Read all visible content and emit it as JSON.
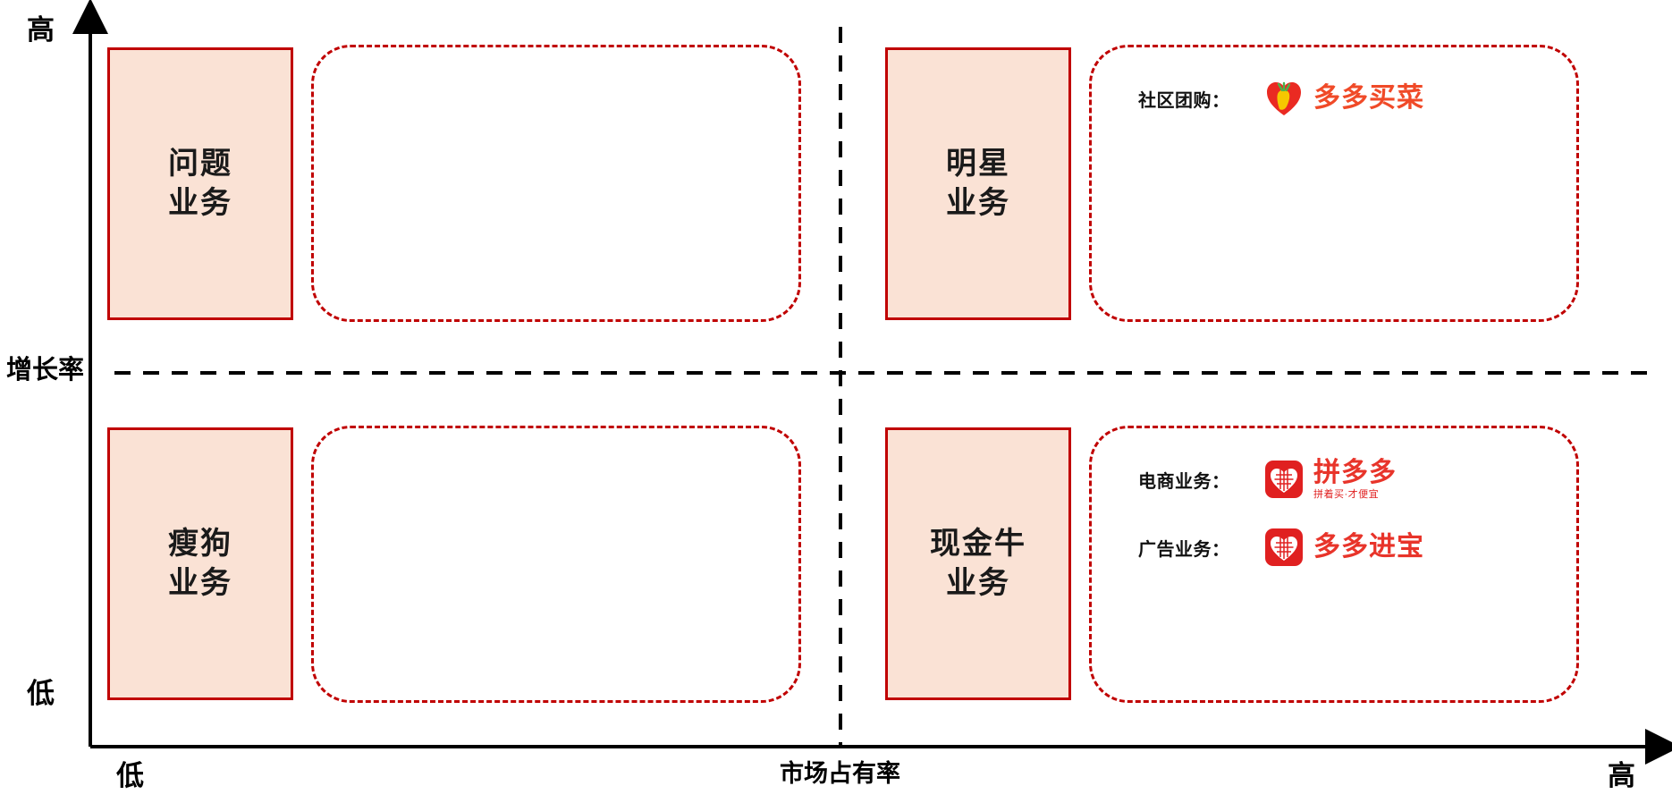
{
  "diagram": {
    "type": "bcg-growth-share-matrix",
    "axes": {
      "y": {
        "name": "增长率",
        "high": "高",
        "low": "低"
      },
      "x": {
        "name": "市场占有率",
        "low": "低",
        "high": "高"
      }
    },
    "colors": {
      "box_fill": "#fae2d5",
      "box_border": "#c00000",
      "panel_border": "#c00000",
      "brand_red": "#e02020",
      "axis": "#000000"
    },
    "quadrants": [
      {
        "id": "question",
        "position": "top-left",
        "title_lines": [
          "问题",
          "业务"
        ],
        "entries": []
      },
      {
        "id": "star",
        "position": "top-right",
        "title_lines": [
          "明星",
          "业务"
        ],
        "entries": [
          {
            "label": "社区团购：",
            "brand": "多多买菜",
            "tagline": "",
            "icon": "carrot-heart-logo-icon"
          }
        ]
      },
      {
        "id": "dog",
        "position": "bottom-left",
        "title_lines": [
          "瘦狗",
          "业务"
        ],
        "entries": []
      },
      {
        "id": "cash-cow",
        "position": "bottom-right",
        "title_lines": [
          "现金牛",
          "业务"
        ],
        "entries": [
          {
            "label": "电商业务：",
            "brand": "拼多多",
            "tagline": "拼着买·才便宜",
            "icon": "pinduoduo-heart-logo-icon"
          },
          {
            "label": "广告业务：",
            "brand": "多多进宝",
            "tagline": "",
            "icon": "duoduo-jinbao-heart-logo-icon"
          }
        ]
      }
    ]
  }
}
